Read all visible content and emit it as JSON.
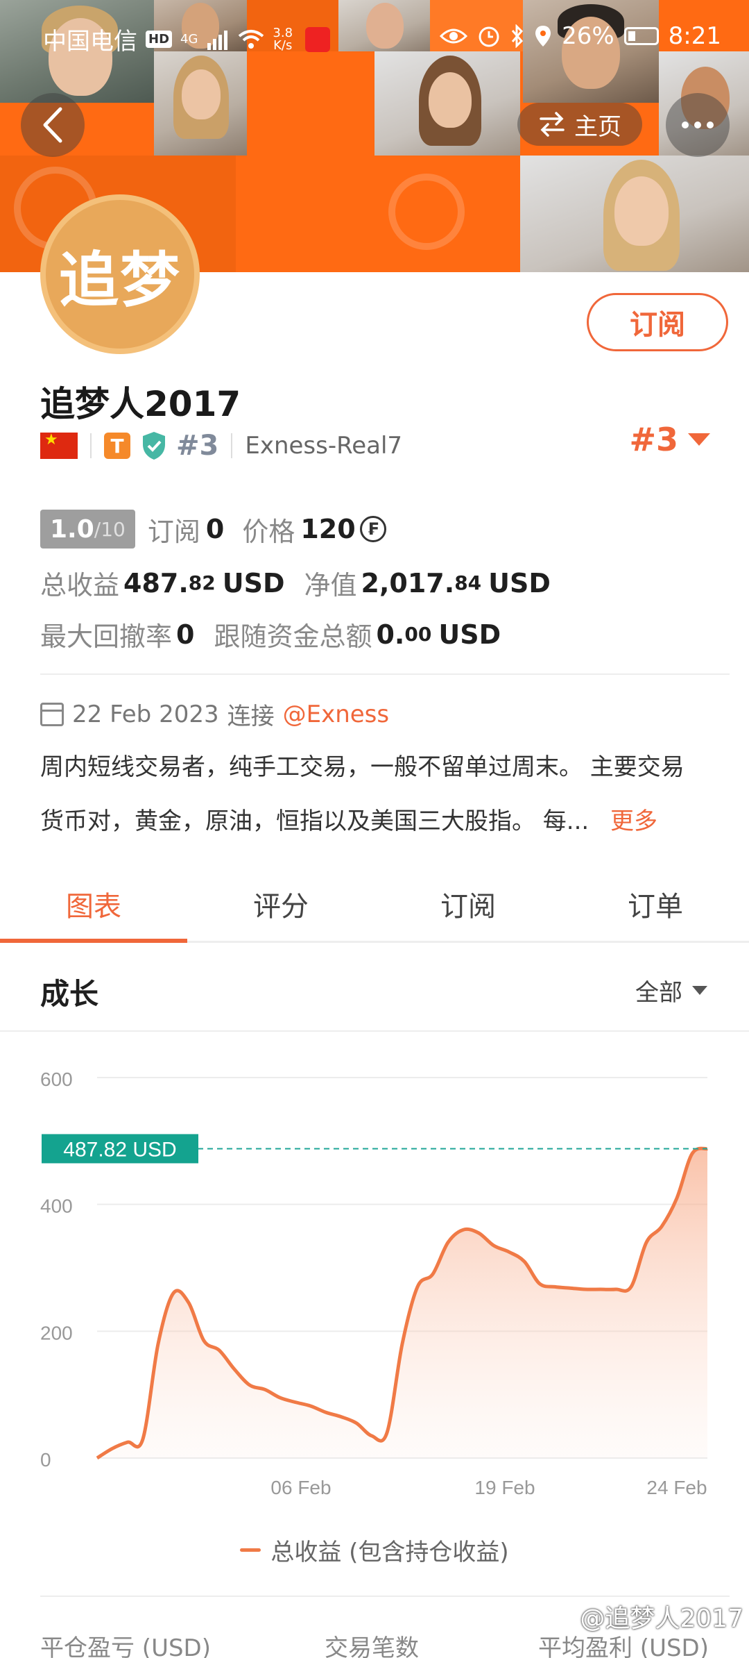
{
  "status_bar": {
    "carrier": "中国电信",
    "hd": "HD",
    "network": "4G",
    "speed_value": "3.8",
    "speed_unit": "K/s",
    "battery": "26%",
    "time": "8:21"
  },
  "header": {
    "home_label": "主页"
  },
  "profile": {
    "avatar_text": "追梦",
    "subscribe_label": "订阅",
    "name": "追梦人2017",
    "tier_badge": "T",
    "rank_small": "#3",
    "broker_account": "Exness-Real7",
    "rank_big": "#3"
  },
  "stats": {
    "score": "1.0",
    "score_max": "/10",
    "subscribe_label": "订阅",
    "subscribe_count": "0",
    "price_label": "价格",
    "price_value": "120",
    "price_currency_symbol": "₣",
    "total_profit_label": "总收益",
    "total_profit_int": "487.",
    "total_profit_dec": "82",
    "total_profit_unit": "USD",
    "equity_label": "净值",
    "equity_int": "2,017.",
    "equity_dec": "84",
    "equity_unit": "USD",
    "max_drawdown_label": "最大回撤率",
    "max_drawdown_value": "0",
    "follow_funds_label": "跟随资金总额",
    "follow_funds_int": "0.",
    "follow_funds_dec": "00",
    "follow_funds_unit": "USD"
  },
  "connection": {
    "date": "22 Feb 2023",
    "connect_label": "连接",
    "broker": "@Exness"
  },
  "description": {
    "line1": "周内短线交易者，纯手工交易，一般不留单过周末。 主要交易",
    "line2": "货币对，黄金，原油，恒指以及美国三大股指。 每...",
    "more": "更多"
  },
  "tabs": [
    {
      "label": "图表",
      "active": true
    },
    {
      "label": "评分",
      "active": false
    },
    {
      "label": "订阅",
      "active": false
    },
    {
      "label": "订单",
      "active": false
    }
  ],
  "growth": {
    "title": "成长",
    "range": "全部",
    "legend": "总收益 (包含持仓收益)"
  },
  "chart_data": {
    "type": "area",
    "ylim": [
      0,
      600
    ],
    "yticks": [
      "0",
      "200",
      "400",
      "600"
    ],
    "xticks": [
      "06 Feb",
      "19 Feb",
      "24 Feb"
    ],
    "current_value_label": "487.82 USD",
    "current_value": 487.82,
    "series": [
      {
        "name": "总收益 (包含持仓收益)",
        "color": "#f07a46",
        "values": [
          0,
          15,
          25,
          30,
          180,
          260,
          245,
          185,
          170,
          140,
          115,
          108,
          95,
          88,
          82,
          72,
          65,
          55,
          35,
          40,
          180,
          270,
          290,
          340,
          360,
          355,
          335,
          325,
          310,
          275,
          270,
          268,
          266,
          266,
          266,
          270,
          340,
          365,
          410,
          480,
          487.82
        ]
      }
    ]
  },
  "bottom_stats": {
    "closed_pnl_label": "平仓盈亏 (USD)",
    "trades_label": "交易笔数",
    "avg_profit_label": "平均盈利 (USD)"
  },
  "watermark": "@追梦人2017"
}
